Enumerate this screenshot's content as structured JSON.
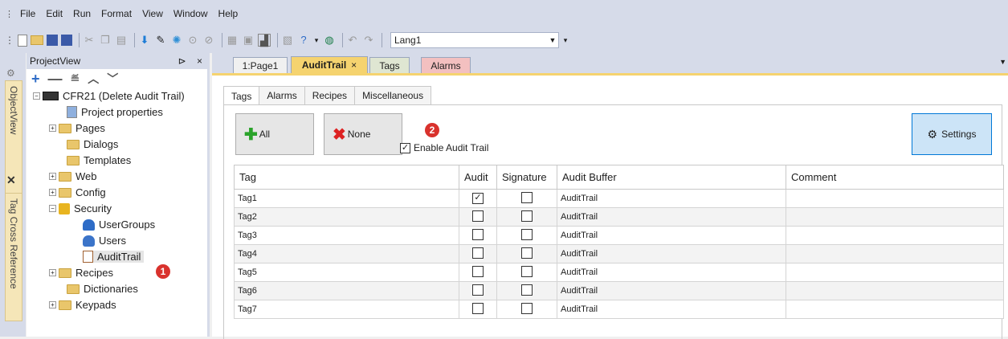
{
  "menu": [
    "File",
    "Edit",
    "Run",
    "Format",
    "View",
    "Window",
    "Help"
  ],
  "toolbar": {
    "language": "Lang1"
  },
  "side_tabs": [
    "ObjectView",
    "Tag Cross Reference"
  ],
  "project_view": {
    "title": "ProjectView",
    "pin": "⊳",
    "close": "×",
    "root": "CFR21 (Delete Audit Trail)",
    "items": {
      "project_properties": "Project properties",
      "pages": "Pages",
      "dialogs": "Dialogs",
      "templates": "Templates",
      "web": "Web",
      "config": "Config",
      "security": "Security",
      "usergroups": "UserGroups",
      "users": "Users",
      "audittrail": "AuditTrail",
      "recipes": "Recipes",
      "dictionaries": "Dictionaries",
      "keypads": "Keypads"
    },
    "badge": "1"
  },
  "doc_tabs": [
    {
      "label": "1:Page1"
    },
    {
      "label": "AuditTrail",
      "close": "×"
    },
    {
      "label": "Tags"
    },
    {
      "label": "Alarms"
    }
  ],
  "inner_tabs": [
    "Tags",
    "Alarms",
    "Recipes",
    "Miscellaneous"
  ],
  "buttons": {
    "all": "All",
    "none": "None",
    "settings": "Settings"
  },
  "enable": {
    "label": "Enable Audit Trail",
    "checked": true,
    "badge": "2"
  },
  "grid": {
    "columns": [
      "Tag",
      "Audit",
      "Signature",
      "Audit Buffer",
      "Comment"
    ],
    "rows": [
      {
        "tag": "Tag1",
        "audit": true,
        "signature": false,
        "buffer": "AuditTrail",
        "comment": ""
      },
      {
        "tag": "Tag2",
        "audit": false,
        "signature": false,
        "buffer": "AuditTrail",
        "comment": ""
      },
      {
        "tag": "Tag3",
        "audit": false,
        "signature": false,
        "buffer": "AuditTrail",
        "comment": ""
      },
      {
        "tag": "Tag4",
        "audit": false,
        "signature": false,
        "buffer": "AuditTrail",
        "comment": ""
      },
      {
        "tag": "Tag5",
        "audit": false,
        "signature": false,
        "buffer": "AuditTrail",
        "comment": ""
      },
      {
        "tag": "Tag6",
        "audit": false,
        "signature": false,
        "buffer": "AuditTrail",
        "comment": ""
      },
      {
        "tag": "Tag7",
        "audit": false,
        "signature": false,
        "buffer": "AuditTrail",
        "comment": ""
      }
    ]
  }
}
